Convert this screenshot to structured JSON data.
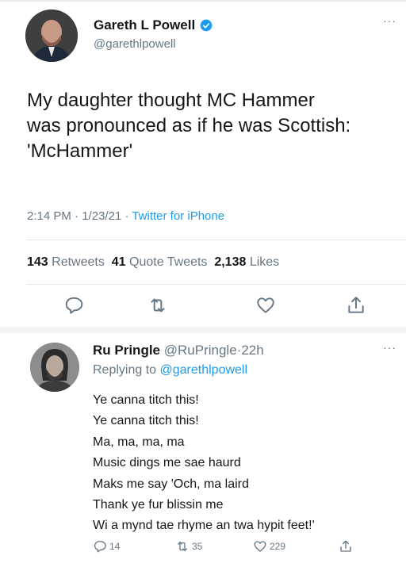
{
  "tweet": {
    "display_name": "Gareth L Powell",
    "handle": "@garethlpowell",
    "text": "My daughter thought MC Hammer\nwas pronounced as if he was Scottish:\n'McHammer'",
    "time": "2:14 PM",
    "date": "1/23/21",
    "separator": "·",
    "source": "Twitter for iPhone",
    "retweets_count": "143",
    "retweets_label": "Retweets",
    "quotes_count": "41",
    "quotes_label": "Quote Tweets",
    "likes_count": "2,138",
    "likes_label": "Likes"
  },
  "reply": {
    "display_name": "Ru Pringle",
    "handle": "@RuPringle",
    "separator": "·",
    "age": "22h",
    "replying_to_label": "Replying to",
    "replying_to_handle": "@garethlpowell",
    "text": "Ye canna titch this!\nYe canna titch this!\nMa, ma, ma, ma\nMusic dings me sae haurd\nMaks me say 'Och, ma laird\nThank ye fur blissin me\nWi a mynd tae rhyme an twa hypit feet!'",
    "reply_count": "14",
    "retweet_count": "35",
    "like_count": "229"
  },
  "icons": {
    "more": "more-icon",
    "verified": "verified-badge-icon",
    "reply": "reply-icon",
    "retweet": "retweet-icon",
    "like": "heart-icon",
    "share": "share-icon"
  },
  "colors": {
    "text": "#14171a",
    "muted": "#657786",
    "link": "#1d9bf0",
    "divider": "#e1e8ed"
  }
}
